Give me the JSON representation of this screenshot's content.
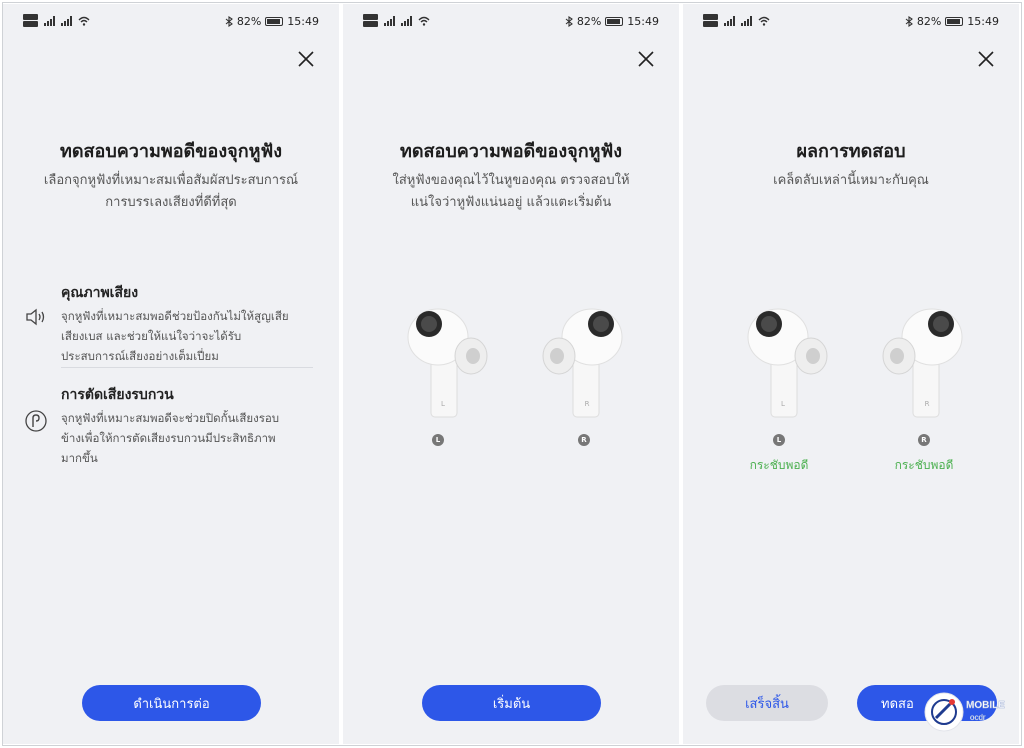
{
  "status_bar": {
    "battery_percent": "82%",
    "time": "15:49",
    "sim1": "SIM1",
    "sim2": "SIM2"
  },
  "screen1": {
    "title": "ทดสอบความพอดีของจุกหูฟัง",
    "subtitle": "เลือกจุกหูฟังที่เหมาะสมเพื่อสัมผัสประสบการณ์\nการบรรเลงเสียงที่ดีที่สุด",
    "features": [
      {
        "icon": "speaker-icon",
        "heading": "คุณภาพเสียง",
        "body": "จุกหูฟังที่เหมาะสมพอดีช่วยป้องกันไม่ให้สูญเสีย\nเสียงเบส และช่วยให้แน่ใจว่าจะได้รับ\nประสบการณ์เสียงอย่างเต็มเปี่ยม"
      },
      {
        "icon": "noise-cancel-icon",
        "heading": "การตัดเสียงรบกวน",
        "body": "จุกหูฟังที่เหมาะสมพอดีจะช่วยปิดกั้นเสียงรอบ\nข้างเพื่อให้การตัดเสียงรบกวนมีประสิทธิภาพ\nมากขึ้น"
      }
    ],
    "continue_label": "ดำเนินการต่อ"
  },
  "screen2": {
    "title": "ทดสอบความพอดีของจุกหูฟัง",
    "subtitle": "ใส่หูฟังของคุณไว้ในหูของคุณ ตรวจสอบให้\nแน่ใจว่าหูฟังแน่นอยู่ แล้วแตะเริ่มต้น",
    "left_marker": "L",
    "right_marker": "R",
    "start_label": "เริ่มต้น"
  },
  "screen3": {
    "title": "ผลการทดสอบ",
    "subtitle": "เคล็ดลับเหล่านี้เหมาะกับคุณ",
    "left_marker": "L",
    "right_marker": "R",
    "left_result": "กระชับพอดี",
    "right_result": "กระชับพอดี",
    "done_label": "เสร็จสิ้น",
    "retest_label": "ทดสอ",
    "result_color": "#4cb050"
  },
  "watermark": {
    "text": "MOBILE"
  },
  "colors": {
    "accent": "#2d57e8",
    "panel_bg": "#f0f1f4"
  }
}
